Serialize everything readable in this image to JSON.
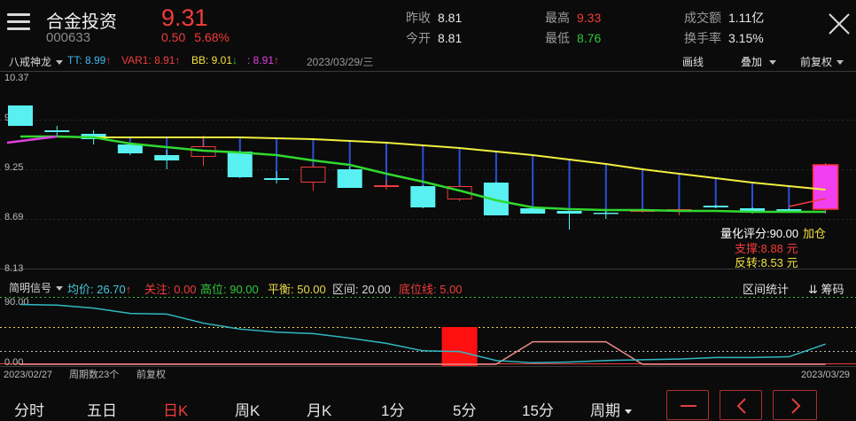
{
  "header": {
    "name": "合金投资",
    "code": "000633",
    "price": "9.31",
    "change": "0.50",
    "change_pct": "5.68%",
    "quotes": [
      {
        "label": "昨收",
        "value": "8.81",
        "color": "#e8e8e8"
      },
      {
        "label": "今开",
        "value": "8.81",
        "color": "#e8e8e8"
      },
      {
        "label": "最高",
        "value": "9.33",
        "color": "#f23b3b"
      },
      {
        "label": "最低",
        "value": "8.76",
        "color": "#2fc73c"
      },
      {
        "label": "成交额",
        "value": "1.11亿",
        "color": "#e8e8e8"
      },
      {
        "label": "换手率",
        "value": "3.15%",
        "color": "#e8e8e8"
      }
    ]
  },
  "toolbar": {
    "indicator": "八戒神龙",
    "tt": "TT: 8.99",
    "var1": "VAR1: 8.91",
    "bb": "BB: 9.01",
    "extra": ": 8.91",
    "date": "2023/03/29/三",
    "draw": "画线",
    "overlay": "叠加",
    "adjust": "前复权"
  },
  "main_chart": {
    "price_labels": [
      "10.37",
      "9.81",
      "9.25",
      "8.69",
      "8.13"
    ],
    "annotations": {
      "score": "量化评分:90.00",
      "add": "加仓",
      "support": "支撑:8.88 元",
      "reverse": "反转:8.53 元"
    }
  },
  "sub_toolbar": {
    "indicator": "简明信号",
    "items": [
      {
        "text": "均价: 26.70",
        "color": "#46c8d8"
      },
      {
        "text": "关注: 0.00",
        "color": "#f23b3b"
      },
      {
        "text": "高位: 90.00",
        "color": "#2fc73c"
      },
      {
        "text": "平衡: 50.00",
        "color": "#e8d84a"
      },
      {
        "text": "区间: 20.00",
        "color": "#d8d8d8"
      },
      {
        "text": "底位线: 5.00",
        "color": "#f23b3b"
      }
    ],
    "range_stats": "区间统计",
    "chips": "筹码"
  },
  "sub_chart": {
    "top_label": "90.00",
    "bottom_label": "0.00"
  },
  "footer_axis": {
    "start": "2023/02/27",
    "count": "周期数23个",
    "adjust": "前复权",
    "end": "2023/03/29"
  },
  "bottom_tabs": [
    {
      "label": "分时"
    },
    {
      "label": "五日"
    },
    {
      "label": "日K"
    },
    {
      "label": "周K"
    },
    {
      "label": "月K"
    },
    {
      "label": "1分"
    },
    {
      "label": "5分"
    },
    {
      "label": "15分"
    },
    {
      "label": "周期"
    }
  ],
  "active_tab": "日K",
  "chart_data": {
    "type": "candlestick",
    "ylim": [
      8.13,
      10.37
    ],
    "candles": [
      {
        "o": 9.98,
        "c": 9.75,
        "h": 9.98,
        "l": 9.75,
        "up": false
      },
      {
        "o": 9.7,
        "c": 9.68,
        "h": 9.75,
        "l": 9.62,
        "up": false
      },
      {
        "o": 9.66,
        "c": 9.6,
        "h": 9.7,
        "l": 9.54,
        "up": false
      },
      {
        "o": 9.54,
        "c": 9.44,
        "h": 9.56,
        "l": 9.42,
        "up": false
      },
      {
        "o": 9.42,
        "c": 9.36,
        "h": 9.48,
        "l": 9.26,
        "up": false
      },
      {
        "o": 9.4,
        "c": 9.52,
        "h": 9.64,
        "l": 9.3,
        "up": true
      },
      {
        "o": 9.46,
        "c": 9.17,
        "h": 9.47,
        "l": 9.16,
        "up": false
      },
      {
        "o": 9.16,
        "c": 9.14,
        "h": 9.24,
        "l": 9.1,
        "up": false
      },
      {
        "o": 9.11,
        "c": 9.29,
        "h": 9.32,
        "l": 9.02,
        "up": true
      },
      {
        "o": 9.26,
        "c": 9.05,
        "h": 9.29,
        "l": 9.05,
        "up": false
      },
      {
        "o": 9.06,
        "c": 9.08,
        "h": 9.14,
        "l": 9.03,
        "up": true
      },
      {
        "o": 9.07,
        "c": 8.83,
        "h": 9.08,
        "l": 8.82,
        "up": false
      },
      {
        "o": 8.92,
        "c": 9.07,
        "h": 9.08,
        "l": 8.9,
        "up": true
      },
      {
        "o": 9.11,
        "c": 8.74,
        "h": 9.12,
        "l": 8.74,
        "up": false
      },
      {
        "o": 8.82,
        "c": 8.76,
        "h": 8.84,
        "l": 8.76,
        "up": false
      },
      {
        "o": 8.79,
        "c": 8.76,
        "h": 8.79,
        "l": 8.58,
        "up": false
      },
      {
        "o": 8.77,
        "c": 8.77,
        "h": 8.79,
        "l": 8.7,
        "up": false
      },
      {
        "o": 8.78,
        "c": 8.8,
        "h": 8.8,
        "l": 8.77,
        "up": true
      },
      {
        "o": 8.79,
        "c": 8.81,
        "h": 8.82,
        "l": 8.74,
        "up": true
      },
      {
        "o": 8.85,
        "c": 8.83,
        "h": 8.86,
        "l": 8.82,
        "up": false
      },
      {
        "o": 8.82,
        "c": 8.77,
        "h": 8.83,
        "l": 8.76,
        "up": false
      },
      {
        "o": 8.81,
        "c": 8.78,
        "h": 8.82,
        "l": 8.77,
        "up": false
      },
      {
        "o": 8.81,
        "c": 9.31,
        "h": 9.33,
        "l": 8.76,
        "up": true
      }
    ],
    "yellow_line": [
      9.63,
      9.63,
      9.62,
      9.62,
      9.62,
      9.62,
      9.62,
      9.61,
      9.6,
      9.58,
      9.56,
      9.53,
      9.5,
      9.46,
      9.42,
      9.37,
      9.32,
      9.26,
      9.21,
      9.16,
      9.11,
      9.07,
      9.03
    ],
    "green_line": [
      9.63,
      9.63,
      9.62,
      9.55,
      9.51,
      9.47,
      9.45,
      9.42,
      9.36,
      9.31,
      9.21,
      9.12,
      9.02,
      8.91,
      8.83,
      8.81,
      8.8,
      8.8,
      8.79,
      8.79,
      8.78,
      8.78,
      8.78
    ],
    "magenta_line": [
      9.56,
      9.63
    ],
    "red_line": [
      8.84,
      8.93
    ],
    "sub_series": {
      "cyan": [
        80,
        79,
        75,
        68,
        67,
        55,
        47,
        43,
        41,
        35,
        28,
        18,
        17,
        5,
        2,
        3,
        5,
        6,
        7,
        9,
        9,
        10,
        27
      ],
      "pink": [
        0,
        0,
        0,
        0,
        0,
        0,
        0,
        0,
        0,
        0,
        0,
        0,
        0,
        0,
        30,
        30,
        30,
        0,
        0,
        0,
        0,
        0,
        0
      ],
      "red_bar_index": 12,
      "ylim": [
        0,
        90
      ]
    }
  }
}
